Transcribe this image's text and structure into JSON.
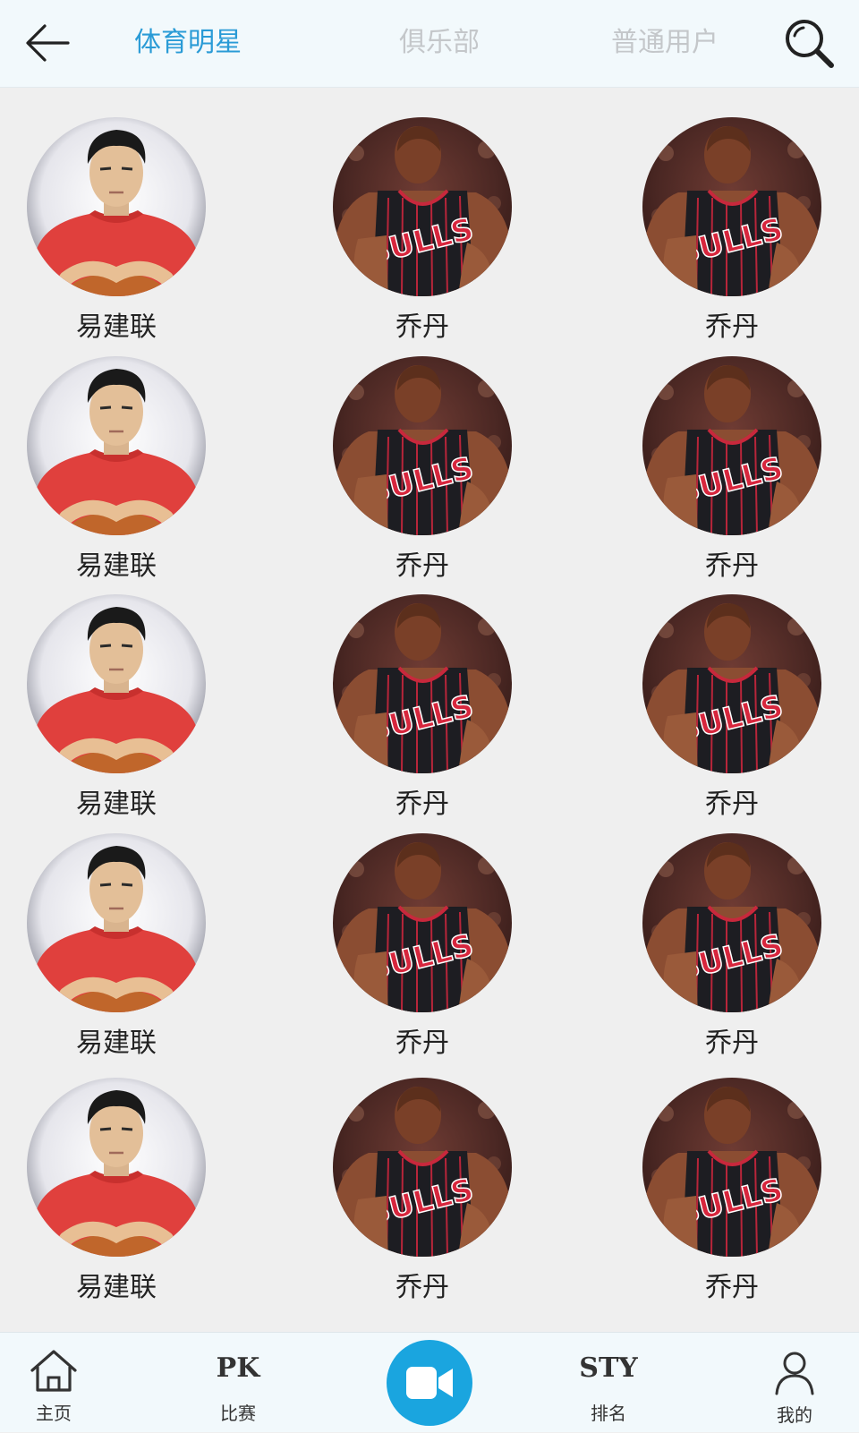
{
  "header": {
    "tabs": [
      {
        "label": "体育明星",
        "active": true
      },
      {
        "label": "俱乐部",
        "active": false
      },
      {
        "label": "普通用户",
        "active": false
      }
    ],
    "back_icon": "arrow-left-icon",
    "search_icon": "search-icon"
  },
  "stars": [
    {
      "name": "易建联",
      "photo": "yi-jianlian"
    },
    {
      "name": "乔丹",
      "photo": "jordan"
    },
    {
      "name": "乔丹",
      "photo": "jordan"
    },
    {
      "name": "易建联",
      "photo": "yi-jianlian"
    },
    {
      "name": "乔丹",
      "photo": "jordan"
    },
    {
      "name": "乔丹",
      "photo": "jordan"
    },
    {
      "name": "易建联",
      "photo": "yi-jianlian"
    },
    {
      "name": "乔丹",
      "photo": "jordan"
    },
    {
      "name": "乔丹",
      "photo": "jordan"
    },
    {
      "name": "易建联",
      "photo": "yi-jianlian"
    },
    {
      "name": "乔丹",
      "photo": "jordan"
    },
    {
      "name": "乔丹",
      "photo": "jordan"
    },
    {
      "name": "易建联",
      "photo": "yi-jianlian"
    },
    {
      "name": "乔丹",
      "photo": "jordan"
    },
    {
      "name": "乔丹",
      "photo": "jordan"
    }
  ],
  "tabbar": {
    "home": {
      "label": "主页",
      "icon": "home-icon"
    },
    "match": {
      "label": "比赛",
      "mark": "PK"
    },
    "record": {
      "icon": "video-camera-icon"
    },
    "rank": {
      "label": "排名",
      "mark": "STY"
    },
    "mine": {
      "label": "我的",
      "icon": "user-icon"
    }
  },
  "colors": {
    "accent": "#2a9bd6",
    "inactive_tab": "#c4c7ca",
    "header_bg": "#f2f9fc",
    "content_bg": "#efefef",
    "record_button": "#1aa5df"
  }
}
